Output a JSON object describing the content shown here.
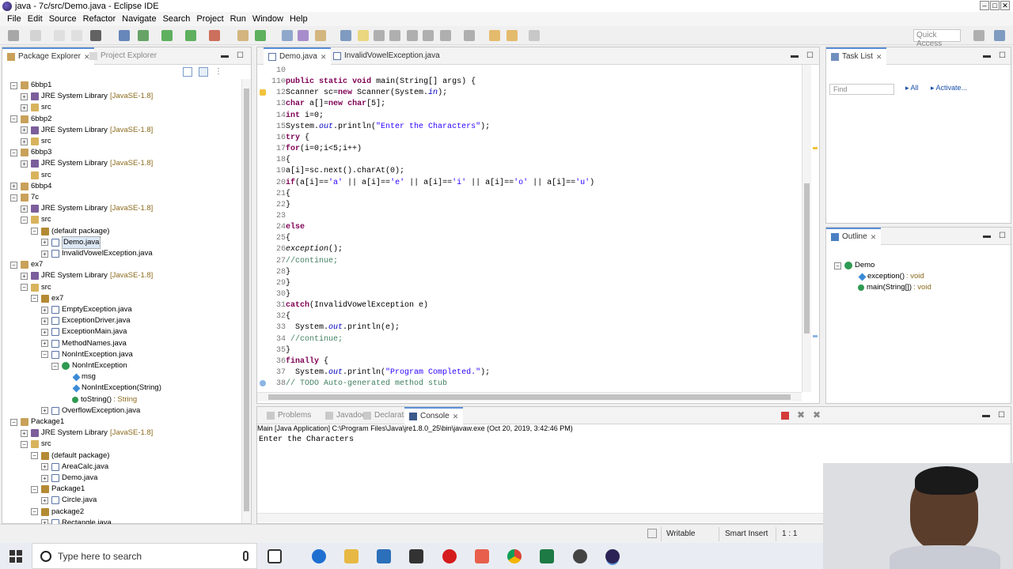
{
  "window": {
    "title": "java - 7c/src/Demo.java - Eclipse IDE"
  },
  "menu": [
    "File",
    "Edit",
    "Source",
    "Refactor",
    "Navigate",
    "Search",
    "Project",
    "Run",
    "Window",
    "Help"
  ],
  "toolbar": {
    "quick_access": "Quick Access"
  },
  "package_explorer": {
    "tab_active": "Package Explorer",
    "tab_inactive": "Project Explorer",
    "tree": [
      {
        "text": "6bbp1",
        "icon": "project",
        "toggle": "−",
        "level": 0
      },
      {
        "text": "JRE System Library",
        "suffix": "[JavaSE-1.8]",
        "icon": "lib",
        "toggle": "+",
        "level": 1
      },
      {
        "text": "src",
        "icon": "src",
        "toggle": "+",
        "level": 1
      },
      {
        "text": "6bbp2",
        "icon": "project",
        "toggle": "−",
        "level": 0
      },
      {
        "text": "JRE System Library",
        "suffix": "[JavaSE-1.8]",
        "icon": "lib",
        "toggle": "+",
        "level": 1
      },
      {
        "text": "src",
        "icon": "src",
        "toggle": "+",
        "level": 1
      },
      {
        "text": "6bbp3",
        "icon": "project",
        "toggle": "−",
        "level": 0
      },
      {
        "text": "JRE System Library",
        "suffix": "[JavaSE-1.8]",
        "icon": "lib",
        "toggle": "+",
        "level": 1
      },
      {
        "text": "src",
        "icon": "src",
        "toggle": "",
        "level": 1
      },
      {
        "text": "6bbp4",
        "icon": "project",
        "toggle": "+",
        "level": 0
      },
      {
        "text": "7c",
        "icon": "project",
        "toggle": "−",
        "level": 0
      },
      {
        "text": "JRE System Library",
        "suffix": "[JavaSE-1.8]",
        "icon": "lib",
        "toggle": "+",
        "level": 1
      },
      {
        "text": "src",
        "icon": "src",
        "toggle": "−",
        "level": 1
      },
      {
        "text": "(default package)",
        "icon": "pkg",
        "toggle": "−",
        "level": 2
      },
      {
        "text": "Demo.java",
        "icon": "java",
        "toggle": "+",
        "level": 3,
        "selected": true
      },
      {
        "text": "InvalidVowelException.java",
        "icon": "java",
        "toggle": "+",
        "level": 3
      },
      {
        "text": "ex7",
        "icon": "project",
        "toggle": "−",
        "level": 0
      },
      {
        "text": "JRE System Library",
        "suffix": "[JavaSE-1.8]",
        "icon": "lib",
        "toggle": "+",
        "level": 1
      },
      {
        "text": "src",
        "icon": "src",
        "toggle": "−",
        "level": 1
      },
      {
        "text": "ex7",
        "icon": "pkg",
        "toggle": "−",
        "level": 2
      },
      {
        "text": "EmptyException.java",
        "icon": "java",
        "toggle": "+",
        "level": 3
      },
      {
        "text": "ExceptionDriver.java",
        "icon": "java",
        "toggle": "+",
        "level": 3
      },
      {
        "text": "ExceptionMain.java",
        "icon": "java",
        "toggle": "+",
        "level": 3
      },
      {
        "text": "MethodNames.java",
        "icon": "java",
        "toggle": "+",
        "level": 3
      },
      {
        "text": "NonIntException.java",
        "icon": "java",
        "toggle": "−",
        "level": 3
      },
      {
        "text": "NonIntException",
        "icon": "cls",
        "toggle": "−",
        "level": 4
      },
      {
        "text": "msg",
        "icon": "fld",
        "toggle": "",
        "level": 5
      },
      {
        "text": "NonIntException(String)",
        "icon": "fld",
        "toggle": "",
        "level": 5
      },
      {
        "text": "toString()",
        "suffix": ": String",
        "icon": "mth",
        "toggle": "",
        "level": 5
      },
      {
        "text": "OverflowException.java",
        "icon": "java",
        "toggle": "+",
        "level": 3
      },
      {
        "text": "Package1",
        "icon": "project",
        "toggle": "−",
        "level": 0
      },
      {
        "text": "JRE System Library",
        "suffix": "[JavaSE-1.8]",
        "icon": "lib",
        "toggle": "+",
        "level": 1
      },
      {
        "text": "src",
        "icon": "src",
        "toggle": "−",
        "level": 1
      },
      {
        "text": "(default package)",
        "icon": "pkg",
        "toggle": "−",
        "level": 2
      },
      {
        "text": "AreaCalc.java",
        "icon": "java",
        "toggle": "+",
        "level": 3
      },
      {
        "text": "Demo.java",
        "icon": "java",
        "toggle": "+",
        "level": 3
      },
      {
        "text": "Package1",
        "icon": "pkg",
        "toggle": "−",
        "level": 2
      },
      {
        "text": "Circle.java",
        "icon": "java",
        "toggle": "+",
        "level": 3
      },
      {
        "text": "package2",
        "icon": "pkg",
        "toggle": "−",
        "level": 2
      },
      {
        "text": "Rectangle.java",
        "icon": "java",
        "toggle": "+",
        "level": 3
      }
    ]
  },
  "editor": {
    "tabs": [
      {
        "label": "Demo.java",
        "active": true
      },
      {
        "label": "InvalidVowelException.java",
        "active": false
      }
    ],
    "lines": [
      {
        "n": "10",
        "html": ""
      },
      {
        "n": "11⊖",
        "html": "<span class='kw'>public</span> <span class='kw'>static</span> <span class='kw'>void</span> main(String[] args) {"
      },
      {
        "n": "12",
        "html": "Scanner sc=<span class='kw'>new</span> Scanner(System.<span class='fld-c'>in</span>);"
      },
      {
        "n": "13",
        "html": "<span class='kw'>char</span> a[]=<span class='kw'>new</span> <span class='kw'>char</span>[5];"
      },
      {
        "n": "14",
        "html": "<span class='kw'>int</span> i=0;"
      },
      {
        "n": "15",
        "html": "System.<span class='fld-c'>out</span>.println(<span class='str'>\"Enter the Characters\"</span>);"
      },
      {
        "n": "16",
        "html": "<span class='kw'>try</span> {"
      },
      {
        "n": "17",
        "html": "<span class='kw'>for</span>(i=0;i&lt;5;i++)"
      },
      {
        "n": "18",
        "html": "{"
      },
      {
        "n": "19",
        "html": "a[i]=sc.next().charAt(0);"
      },
      {
        "n": "20",
        "html": "<span class='kw'>if</span>(a[i]==<span class='str'>'a'</span> || a[i]==<span class='str'>'e'</span> || a[i]==<span class='str'>'i'</span> || a[i]==<span class='str'>'o'</span> || a[i]==<span class='str'>'u'</span>)"
      },
      {
        "n": "21",
        "html": "{"
      },
      {
        "n": "22",
        "html": "}"
      },
      {
        "n": "23",
        "html": ""
      },
      {
        "n": "24",
        "html": "<span class='kw'>else</span>"
      },
      {
        "n": "25",
        "html": "{"
      },
      {
        "n": "26",
        "html": "<span class='itl'>exception</span>();"
      },
      {
        "n": "27",
        "html": "<span class='cmt'>//continue;</span>"
      },
      {
        "n": "28",
        "html": "}"
      },
      {
        "n": "29",
        "html": "}"
      },
      {
        "n": "30",
        "html": "}"
      },
      {
        "n": "31",
        "html": "<span class='kw'>catch</span>(InvalidVowelException e)"
      },
      {
        "n": "32",
        "html": "{"
      },
      {
        "n": "33",
        "html": "  System.<span class='fld-c'>out</span>.println(e);"
      },
      {
        "n": "34",
        "html": " <span class='cmt'>//continue;</span>"
      },
      {
        "n": "35",
        "html": "}"
      },
      {
        "n": "36",
        "html": "<span class='kw'>finally</span> {"
      },
      {
        "n": "37",
        "html": "  System.<span class='fld-c'>out</span>.println(<span class='str'>\"Program Completed.\"</span>);"
      },
      {
        "n": "38",
        "html": "<span class='cmt'>// TODO Auto-generated method stub</span>"
      }
    ]
  },
  "task_list": {
    "title": "Task List",
    "find_placeholder": "Find",
    "all_label": "All",
    "activate_label": "Activate..."
  },
  "outline": {
    "title": "Outline",
    "root": "Demo",
    "items": [
      {
        "name": "exception()",
        "type": ": void"
      },
      {
        "name": "main(String[])",
        "type": ": void"
      }
    ]
  },
  "bottom_panel": {
    "tabs": [
      "Problems",
      "Javadoc",
      "Declaration",
      "Console"
    ],
    "active_tab": "Console",
    "header": "Main [Java Application] C:\\Program Files\\Java\\jre1.8.0_25\\bin\\javaw.exe (Oct 20, 2019, 3:42:46 PM)",
    "output": "Enter the Characters"
  },
  "status": {
    "writable": "Writable",
    "insert_mode": "Smart Insert",
    "position": "1 : 1"
  },
  "taskbar": {
    "search_placeholder": "Type here to search"
  }
}
